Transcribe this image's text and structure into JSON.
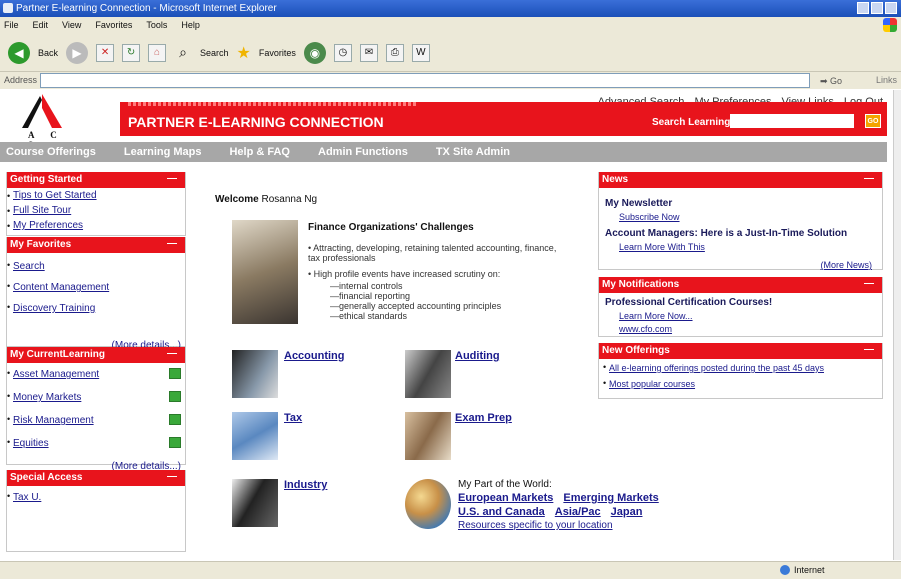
{
  "window": {
    "title": "Partner E-learning Connection - Microsoft Internet Explorer"
  },
  "menu": [
    "File",
    "Edit",
    "View",
    "Favorites",
    "Tools",
    "Help"
  ],
  "toolbar": {
    "back": "Back",
    "search": "Search",
    "favorites": "Favorites"
  },
  "addressbar": {
    "label": "Address",
    "go": "Go",
    "links": "Links"
  },
  "header": {
    "logo_text": "A C S",
    "title": "PARTNER E-LEARNING CONNECTION",
    "search_label": "Search Learning:",
    "search_go": "GO",
    "top_links": [
      "Advanced Search",
      "My Preferences",
      "View Links",
      "Log Out"
    ]
  },
  "nav": [
    "Course Offerings",
    "Learning Maps",
    "Help & FAQ",
    "Admin Functions",
    "TX Site Admin"
  ],
  "left": {
    "getting_started": {
      "title": "Getting Started",
      "items": [
        "Tips to Get Started",
        "Full Site Tour",
        "My Preferences"
      ]
    },
    "favorites": {
      "title": "My Favorites",
      "items": [
        "Search",
        "Content Management",
        "Discovery Training"
      ],
      "more": "(More details...)"
    },
    "current": {
      "title": "My CurrentLearning",
      "items": [
        "Asset Management",
        "Money Markets",
        "Risk Management",
        "Equities"
      ],
      "more": "(More details...)"
    },
    "special": {
      "title": "Special Access",
      "items": [
        "Tax U."
      ]
    }
  },
  "center": {
    "welcome_label": "Welcome",
    "user": "Rosanna Ng",
    "challenges_title": "Finance Organizations' Challenges",
    "bullet1": "• Attracting, developing, retaining talented accounting, finance, tax professionals",
    "bullet2": "• High profile events have increased scrutiny on:",
    "subs": [
      "—internal controls",
      "—financial reporting",
      "—generally accepted accounting principles",
      "—ethical standards"
    ],
    "categories": {
      "accounting": "Accounting",
      "auditing": "Auditing",
      "tax": "Tax",
      "exam": "Exam Prep",
      "industry": "Industry"
    },
    "world": {
      "label": "My Part of the World:",
      "row1": [
        "European Markets",
        "Emerging Markets"
      ],
      "row2": [
        "U.S. and Canada",
        "Asia/Pac",
        "Japan"
      ],
      "resources": "Resources specific to your location"
    }
  },
  "right": {
    "news": {
      "title": "News",
      "item1": "My Newsletter",
      "item1_link": "Subscribe Now",
      "item2": "Account Managers: Here is a Just-In-Time Solution",
      "item2_link": "Learn More With This",
      "more": "(More News)"
    },
    "notifications": {
      "title": "My Notifications",
      "item": "Professional Certification Courses!",
      "link1": "Learn More Now...",
      "link2": "www.cfo.com"
    },
    "offerings": {
      "title": "New Offerings",
      "items": [
        "All e-learning offerings posted during the past 45 days",
        "Most popular courses"
      ]
    }
  },
  "status": {
    "zone": "Internet"
  },
  "colors": {
    "brand_red": "#e8141c",
    "nav_gray": "#a7a7a7"
  }
}
